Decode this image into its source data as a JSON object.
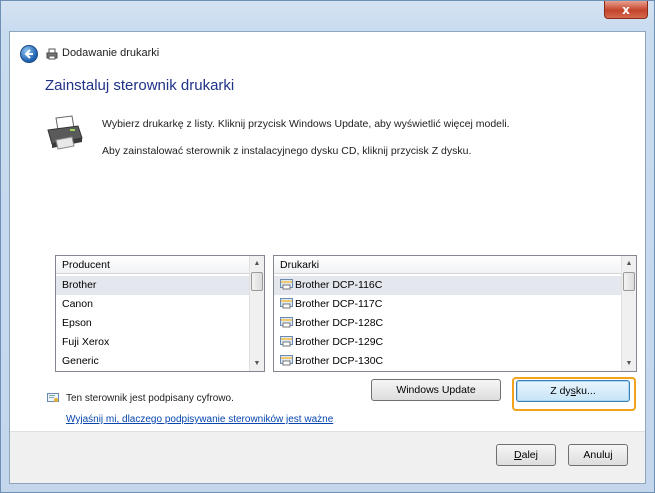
{
  "window": {
    "close_glyph": "x"
  },
  "header": {
    "title": "Dodawanie drukarki"
  },
  "main": {
    "heading": "Zainstaluj sterownik drukarki",
    "instruction_1": "Wybierz drukarkę z listy. Kliknij przycisk Windows Update, aby wyświetlić więcej modeli.",
    "instruction_2": "Aby zainstalować sterownik z instalacyjnego dysku CD, kliknij przycisk Z dysku."
  },
  "manufacturers": {
    "header": "Producent",
    "items": [
      "Brother",
      "Canon",
      "Epson",
      "Fuji Xerox",
      "Generic"
    ],
    "selected_index": 0
  },
  "printers": {
    "header": "Drukarki",
    "items": [
      "Brother DCP-116C",
      "Brother DCP-117C",
      "Brother DCP-128C",
      "Brother DCP-129C",
      "Brother DCP-130C"
    ],
    "selected_index": 0
  },
  "signature": {
    "text": "Ten sterownik jest podpisany cyfrowo.",
    "link": "Wyjaśnij mi, dlaczego podpisywanie sterowników jest ważne"
  },
  "buttons": {
    "windows_update": "Windows Update",
    "have_disk_prefix": "Z dy",
    "have_disk_accel": "s",
    "have_disk_suffix": "ku...",
    "next_accel": "D",
    "next_rest": "alej",
    "cancel": "Anuluj"
  },
  "colors": {
    "heading": "#1e3287",
    "highlight": "#f3a21c",
    "link": "#0645ad"
  }
}
